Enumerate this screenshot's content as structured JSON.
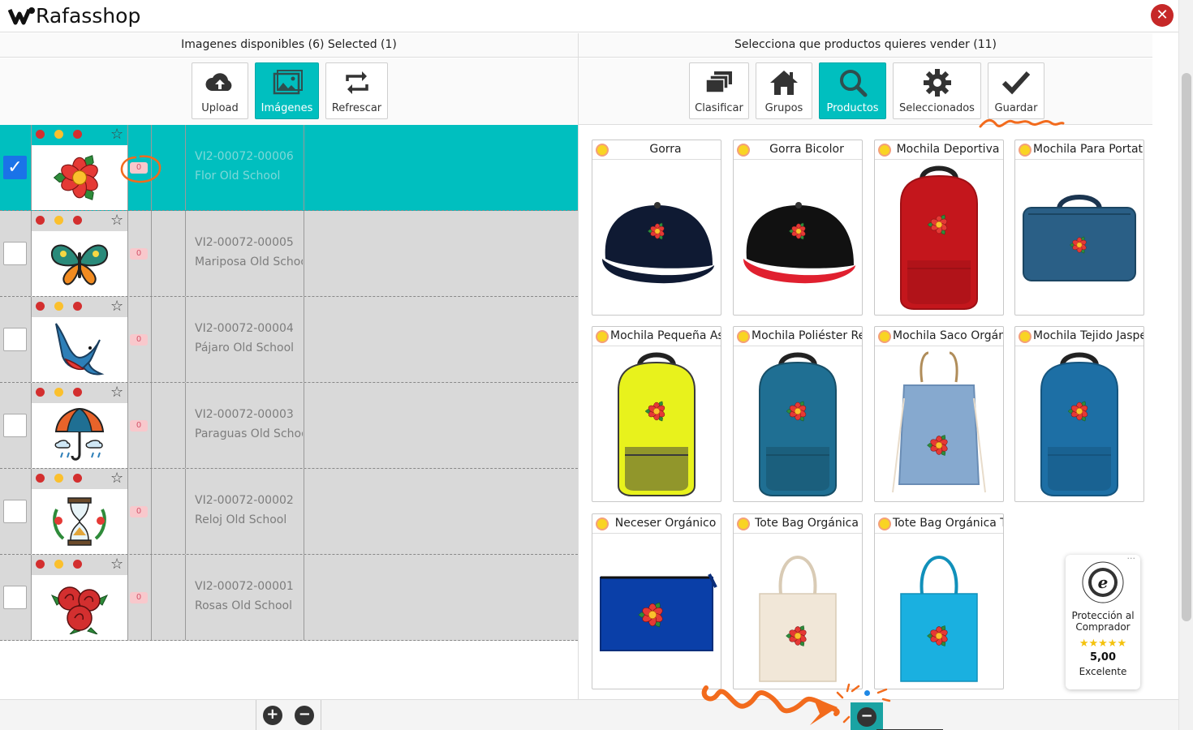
{
  "app": {
    "title": "Rafasshop",
    "close_icon": "close-icon"
  },
  "left_panel": {
    "title": "Imagenes disponibles (6) Selected (1)",
    "toolbar": [
      {
        "label": "Upload",
        "icon": "cloud-upload-icon",
        "active": false
      },
      {
        "label": "Imágenes",
        "icon": "images-icon",
        "active": true
      },
      {
        "label": "Refrescar",
        "icon": "refresh-icon",
        "active": false
      }
    ],
    "images": [
      {
        "code": "VI2-00072-00006",
        "name": "Flor Old School",
        "count": "0",
        "selected": true,
        "art": "flower"
      },
      {
        "code": "VI2-00072-00005",
        "name": "Mariposa Old School",
        "count": "0",
        "selected": false,
        "art": "butterfly"
      },
      {
        "code": "VI2-00072-00004",
        "name": "Pájaro Old School",
        "count": "0",
        "selected": false,
        "art": "bird"
      },
      {
        "code": "VI2-00072-00003",
        "name": "Paraguas Old School",
        "count": "0",
        "selected": false,
        "art": "umbrella"
      },
      {
        "code": "VI2-00072-00002",
        "name": "Reloj Old School",
        "count": "0",
        "selected": false,
        "art": "hourglass"
      },
      {
        "code": "VI2-00072-00001",
        "name": "Rosas Old School",
        "count": "0",
        "selected": false,
        "art": "roses"
      }
    ]
  },
  "right_panel": {
    "title": "Selecciona que productos quieres vender (11)",
    "toolbar": [
      {
        "label": "Clasificar",
        "icon": "layers-icon",
        "active": false
      },
      {
        "label": "Grupos",
        "icon": "home-icon",
        "active": false
      },
      {
        "label": "Productos",
        "icon": "search-icon",
        "active": true
      },
      {
        "label": "Seleccionados",
        "icon": "gear-icon",
        "active": false
      },
      {
        "label": "Guardar",
        "icon": "checkmark-icon",
        "active": false
      }
    ],
    "products": [
      {
        "name": "Gorra",
        "kind": "cap",
        "color": "#0f1a33",
        "accent": "#0f1a33"
      },
      {
        "name": "Gorra Bicolor",
        "kind": "cap",
        "color": "#111111",
        "accent": "#e0202f"
      },
      {
        "name": "Mochila Deportiva",
        "kind": "backpack",
        "color": "#c4161c",
        "accent": "#9e1015"
      },
      {
        "name": "Mochila Para Portatil",
        "kind": "laptopbag",
        "color": "#2a5f86",
        "accent": "#1b4562"
      },
      {
        "name": "Mochila Pequeña Asa",
        "kind": "backpack",
        "color": "#e8f21c",
        "accent": "#3a3a3a"
      },
      {
        "name": "Mochila Poliéster Rec",
        "kind": "backpack",
        "color": "#1f6f93",
        "accent": "#174f68"
      },
      {
        "name": "Mochila Saco Orgánic",
        "kind": "drawstring",
        "color": "#86a9cf",
        "accent": "#6a8db5"
      },
      {
        "name": "Mochila Tejido Jaspea",
        "kind": "backpack",
        "color": "#1d6fa5",
        "accent": "#15557f"
      },
      {
        "name": "Neceser Orgánico",
        "kind": "pouch",
        "color": "#0a3fa8",
        "accent": "#072e7c"
      },
      {
        "name": "Tote Bag Orgánica",
        "kind": "tote",
        "color": "#f1e7d8",
        "accent": "#d9cbb5"
      },
      {
        "name": "Tote Bag Orgánica Te",
        "kind": "tote",
        "color": "#1ab0e0",
        "accent": "#1190ba"
      }
    ]
  },
  "trust_badge": {
    "line1": "Protección al Comprador",
    "stars": "★★★★★",
    "score": "5,00",
    "label": "Excelente",
    "more": "···"
  },
  "bottom_bar": {
    "add_icon": "plus-icon",
    "remove_icon": "minus-icon"
  },
  "colors": {
    "accent": "#00bfbf",
    "close": "#c62828",
    "annotation": "#f26b1d"
  }
}
